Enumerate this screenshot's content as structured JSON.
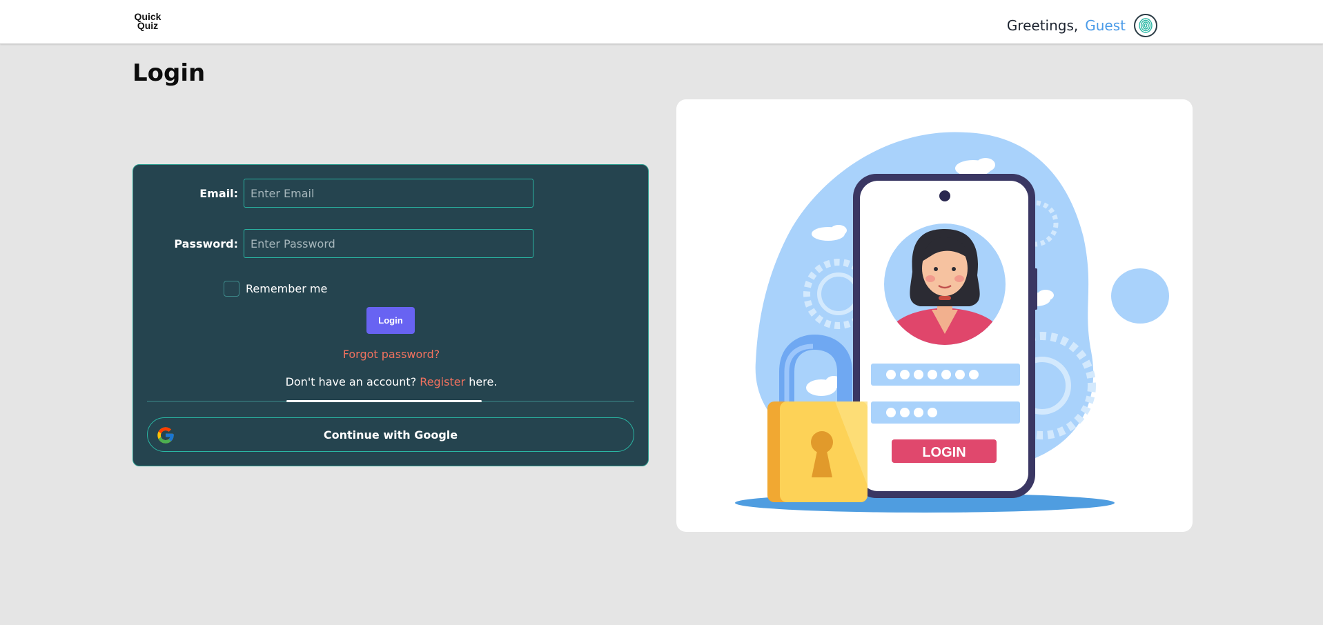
{
  "navbar": {
    "logo_line1": "Quick",
    "logo_line2": "Quiz",
    "greeting_word": "Greetings,",
    "user_name": "Guest",
    "profile_icon": "fingerprint-icon"
  },
  "page": {
    "title": "Login"
  },
  "form": {
    "email_label": "Email:",
    "email_placeholder": "Enter Email",
    "email_value": "",
    "password_label": "Password:",
    "password_placeholder": "Enter Password",
    "password_value": "",
    "remember_label": "Remember me",
    "remember_checked": false,
    "login_button": "Login",
    "forgot_password": "Forgot password?",
    "no_account_prefix": "Don't have an account?",
    "register_link": "Register",
    "no_account_suffix": "here.",
    "google_button": "Continue with Google"
  },
  "illustration": {
    "phone_button_text": "LOGIN"
  },
  "colors": {
    "card_bg": "#25444f",
    "accent_teal": "#2ab7a4",
    "login_button": "#6863f2",
    "link_coral": "#f2725f",
    "guest_blue": "#4a9be8"
  }
}
